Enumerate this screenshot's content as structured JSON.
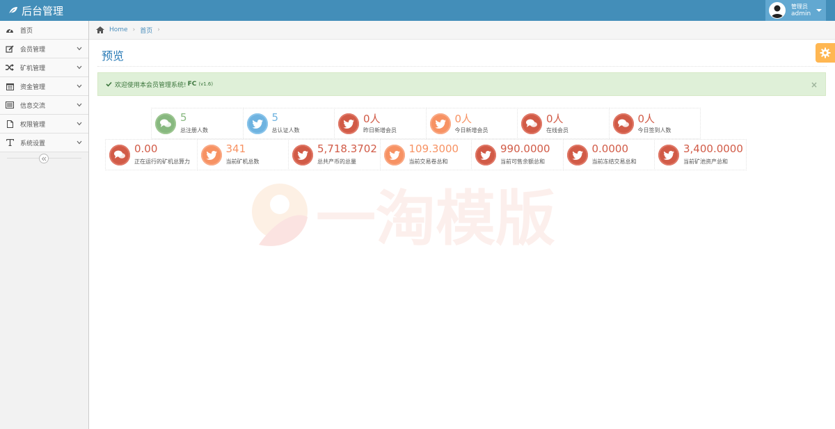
{
  "navbar": {
    "brand": "后台管理",
    "user_role": "管理员",
    "user_name": "admin"
  },
  "sidebar": {
    "items": [
      {
        "label": "首页",
        "icon": "tachometer-icon",
        "has_submenu": false
      },
      {
        "label": "会员管理",
        "icon": "edit-icon",
        "has_submenu": true
      },
      {
        "label": "矿机管理",
        "icon": "random-icon",
        "has_submenu": true
      },
      {
        "label": "资金管理",
        "icon": "calendar-icon",
        "has_submenu": true
      },
      {
        "label": "信息交流",
        "icon": "list-alt-icon",
        "has_submenu": true
      },
      {
        "label": "权限管理",
        "icon": "file-icon",
        "has_submenu": true
      },
      {
        "label": "系统设置",
        "icon": "text-icon",
        "has_submenu": true
      }
    ]
  },
  "breadcrumb": {
    "home": "Home",
    "current": "首页"
  },
  "page": {
    "title": "预览"
  },
  "alert": {
    "text": "欢迎使用本会员管理系统!",
    "strong": "FC",
    "version": "(v1.6)",
    "close": "×"
  },
  "stats_row1": [
    {
      "value": "5",
      "label": "总注册人数",
      "color": "green",
      "icon": "comments-icon"
    },
    {
      "value": "5",
      "label": "总认证人数",
      "color": "blue",
      "icon": "twitter-icon"
    },
    {
      "value": "0人",
      "label": "昨日新增会员",
      "color": "red",
      "icon": "twitter-icon"
    },
    {
      "value": "0人",
      "label": "今日新增会员",
      "color": "orange",
      "icon": "twitter-icon"
    },
    {
      "value": "0人",
      "label": "在线会员",
      "color": "red",
      "icon": "comments-icon"
    },
    {
      "value": "0人",
      "label": "今日签到人数",
      "color": "red",
      "icon": "comments-icon"
    }
  ],
  "stats_row2": [
    {
      "value": "0.00",
      "label": "正在运行的矿机总算力",
      "color": "red",
      "icon": "comments-icon"
    },
    {
      "value": "341",
      "label": "当前矿机总数",
      "color": "orange",
      "icon": "twitter-icon"
    },
    {
      "value": "5,718.3702",
      "label": "总共产币的总量",
      "color": "red",
      "icon": "twitter-icon"
    },
    {
      "value": "109.3000",
      "label": "当前交易卷总和",
      "color": "orange",
      "icon": "twitter-icon"
    },
    {
      "value": "990.0000",
      "label": "当前可售余额总和",
      "color": "red",
      "icon": "twitter-icon"
    },
    {
      "value": "0.0000",
      "label": "当前冻结交易总和",
      "color": "red",
      "icon": "twitter-icon"
    },
    {
      "value": "3,400.0000",
      "label": "当前矿池资产总和",
      "color": "red",
      "icon": "twitter-icon"
    }
  ],
  "colors": {
    "navbar": "#438eb9",
    "green": "#87b87f",
    "blue": "#6fb3e0",
    "red": "#d15b47",
    "orange": "#f79263"
  },
  "watermark": {
    "text": "一淘模版"
  }
}
